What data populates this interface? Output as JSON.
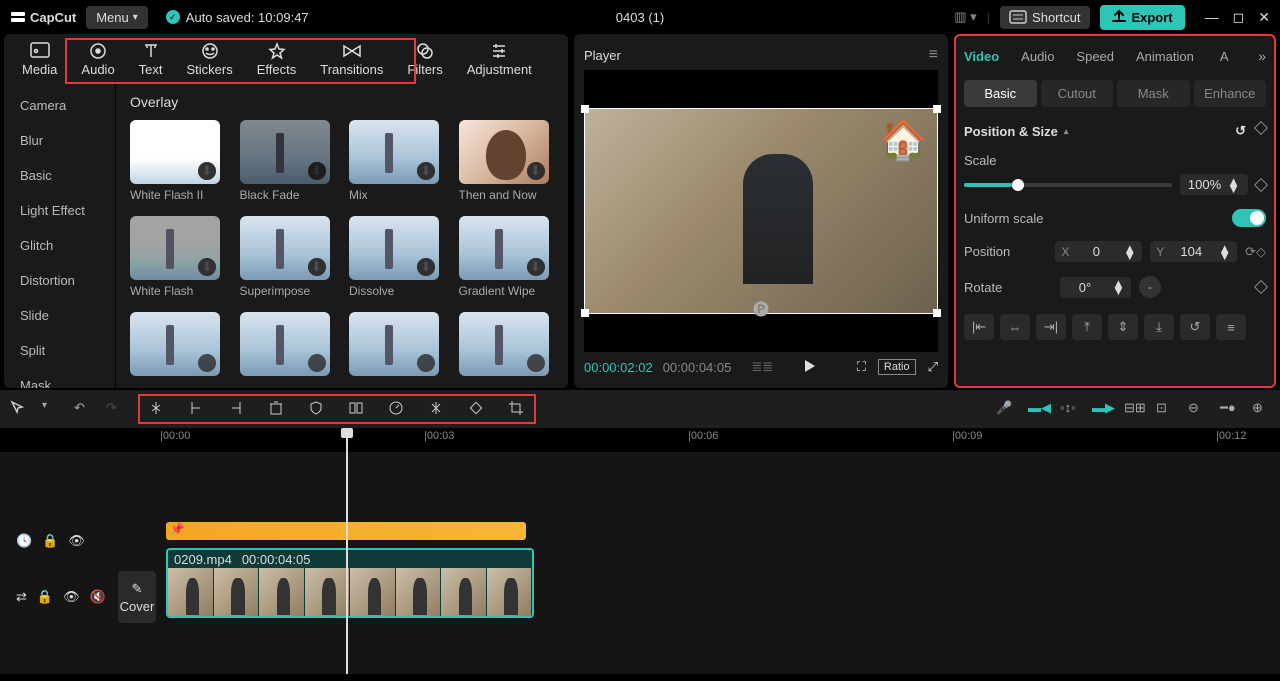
{
  "title_bar": {
    "app": "CapCut",
    "menu": "Menu",
    "autosave": "Auto saved: 10:09:47",
    "doc": "0403 (1)",
    "shortcut": "Shortcut",
    "export": "Export"
  },
  "tool_tabs": [
    "Media",
    "Audio",
    "Text",
    "Stickers",
    "Effects",
    "Transitions",
    "Filters",
    "Adjustment"
  ],
  "tool_tab_active": 5,
  "side_list": [
    "Camera",
    "Blur",
    "Basic",
    "Light Effect",
    "Glitch",
    "Distortion",
    "Slide",
    "Split",
    "Mask"
  ],
  "overlay_title": "Overlay",
  "thumbs": [
    {
      "label": "White Flash II"
    },
    {
      "label": "Black Fade"
    },
    {
      "label": "Mix"
    },
    {
      "label": "Then and Now"
    },
    {
      "label": "White Flash"
    },
    {
      "label": "Superimpose"
    },
    {
      "label": "Dissolve"
    },
    {
      "label": "Gradient Wipe"
    },
    {
      "label": ""
    },
    {
      "label": ""
    },
    {
      "label": ""
    },
    {
      "label": ""
    }
  ],
  "player": {
    "title": "Player",
    "cur": "00:00:02:02",
    "dur": "00:00:04:05",
    "ratio": "Ratio"
  },
  "rp_tabs": [
    "Video",
    "Audio",
    "Speed",
    "Animation"
  ],
  "rp_tab_tail": "A",
  "sub_tabs": [
    "Basic",
    "Cutout",
    "Mask",
    "Enhance"
  ],
  "section": "Position & Size",
  "scale": {
    "label": "Scale",
    "value": "100%"
  },
  "uniform": {
    "label": "Uniform scale"
  },
  "position": {
    "label": "Position",
    "x": "0",
    "y": "104"
  },
  "rotate": {
    "label": "Rotate",
    "value": "0°"
  },
  "ruler": [
    "|00:00",
    "|00:03",
    "|00:06",
    "|00:09",
    "|00:12"
  ],
  "clip": {
    "name": "0209.mp4",
    "dur": "00:00:04:05",
    "cover": "Cover"
  }
}
